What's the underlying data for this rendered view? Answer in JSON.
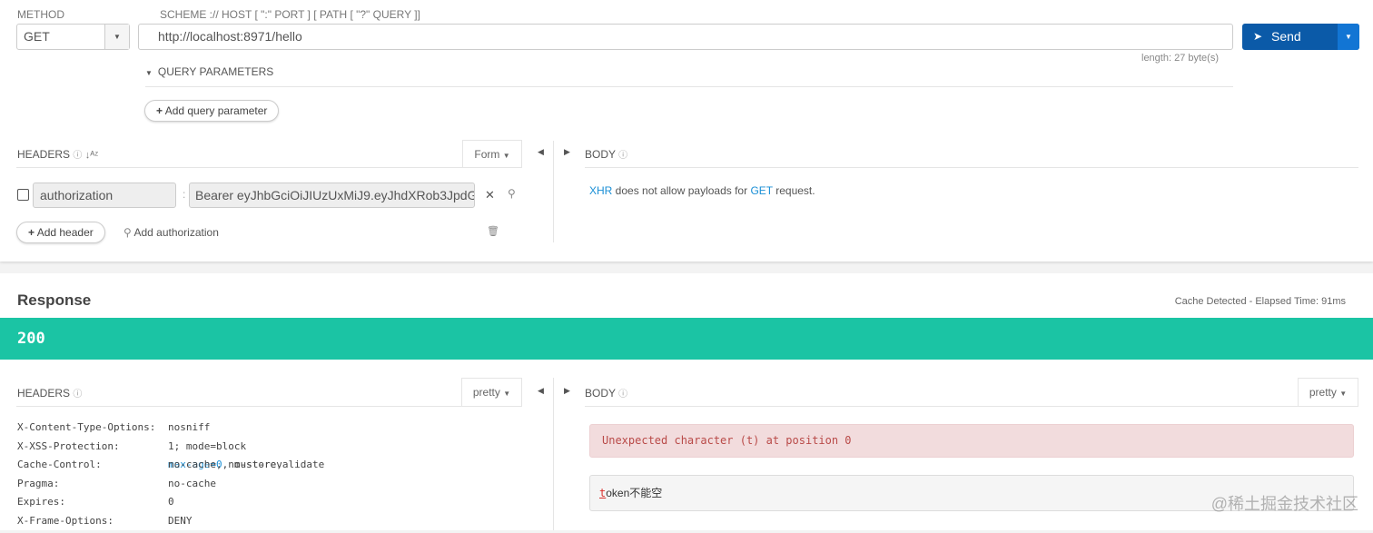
{
  "request": {
    "method_label": "METHOD",
    "method": "GET",
    "url_label": "SCHEME :// HOST [ \":\" PORT ] [ PATH [ \"?\" QUERY ]]",
    "url": "http://localhost:8971/hello",
    "length": "length: 27 byte(s)",
    "send": "Send",
    "query_params": "QUERY PARAMETERS",
    "add_query": "Add query parameter",
    "headers_label": "HEADERS",
    "headers_mode": "Form",
    "header_name": "authorization",
    "header_value": "Bearer eyJhbGciOiJIUzUxMiJ9.eyJhdXRob3JpdG",
    "add_header": "Add header",
    "add_auth": "Add authorization",
    "body_label": "BODY",
    "body_msg_xhr": "XHR",
    "body_msg_mid": " does not allow payloads for ",
    "body_msg_get": "GET",
    "body_msg_end": " request."
  },
  "response": {
    "title": "Response",
    "meta": "Cache Detected - Elapsed Time: 91ms",
    "status": "200",
    "status_color": "#1bc4a4",
    "headers_label": "HEADERS",
    "headers_mode": "pretty",
    "body_label": "BODY",
    "body_mode": "pretty",
    "headers": [
      {
        "k": "X-Content-Type-Options:",
        "v": "nosniff"
      },
      {
        "k": "X-XSS-Protection:",
        "v": "1; mode=block"
      },
      {
        "k": "Cache-Control:",
        "v": "no-cache, no-store, ",
        "v_hl": "max-age=0",
        "v_end": ", must-revalidate"
      },
      {
        "k": "Pragma:",
        "v": "no-cache"
      },
      {
        "k": "Expires:",
        "v": "0"
      },
      {
        "k": "X-Frame-Options:",
        "v": "DENY"
      }
    ],
    "error": "Unexpected character (t) at position 0",
    "body_first": "t",
    "body_rest": "oken不能空",
    "watermark": "@稀土掘金技术社区"
  }
}
